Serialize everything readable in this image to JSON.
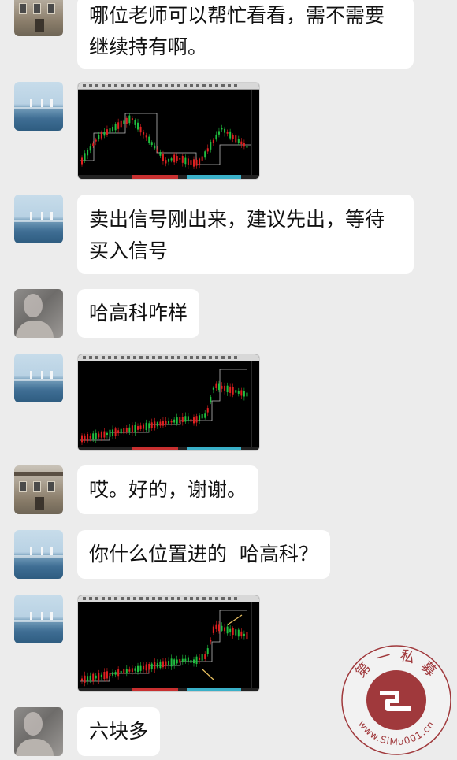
{
  "messages": [
    {
      "sender": "building-avatar",
      "lines": [
        "哪位老师可以帮忙看看，需不需要",
        "继续持有啊。"
      ]
    },
    {
      "sender": "sea-avatar",
      "type": "image",
      "image": "candlestick-chart-1"
    },
    {
      "sender": "sea-avatar",
      "lines": [
        "卖出信号刚出来，建议先出，等待",
        "买入信号"
      ]
    },
    {
      "sender": "person-avatar",
      "lines": [
        "哈高科咋样"
      ]
    },
    {
      "sender": "sea-avatar",
      "type": "image",
      "image": "candlestick-chart-2"
    },
    {
      "sender": "building-avatar",
      "lines": [
        "哎。好的，谢谢。"
      ]
    },
    {
      "sender": "sea-avatar",
      "lines": [
        "你什么位置进的  哈高科？"
      ]
    },
    {
      "sender": "sea-avatar",
      "type": "image",
      "image": "candlestick-chart-3"
    },
    {
      "sender": "person-avatar",
      "lines": [
        "六块多"
      ]
    }
  ],
  "watermark": {
    "top_text": "第 一 私 募",
    "url_text": "www.SiMu001.cn",
    "color": "#a0393c"
  },
  "colors": {
    "background": "#ececec",
    "bubble": "#ffffff",
    "up_candle": "#e02020",
    "down_candle": "#20c040"
  }
}
